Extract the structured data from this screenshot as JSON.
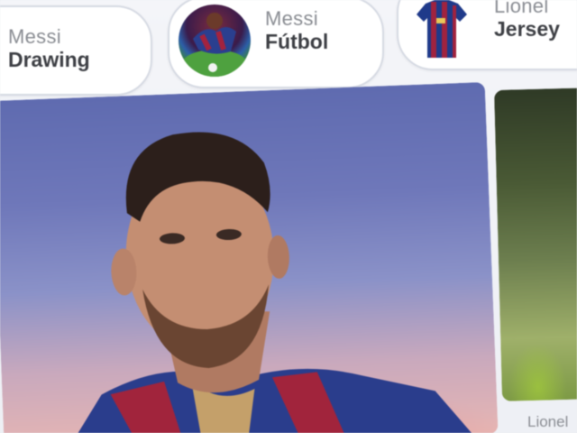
{
  "chips": [
    {
      "top": "Messi",
      "bottom": "Drawing"
    },
    {
      "top": "Messi",
      "bottom": "Fútbol"
    },
    {
      "top": "Lionel",
      "bottom": "Jersey"
    }
  ],
  "results": [
    {
      "caption": ""
    },
    {
      "caption": "Lionel"
    }
  ],
  "colors": {
    "chip_border": "#d6dae3",
    "chip_top_text": "#8a8d93",
    "chip_bottom_text": "#3d3f44",
    "page_bg": "#eef0f5"
  },
  "icons": [
    "soccer-ball-thumbnail-icon",
    "jersey-thumbnail-icon"
  ]
}
